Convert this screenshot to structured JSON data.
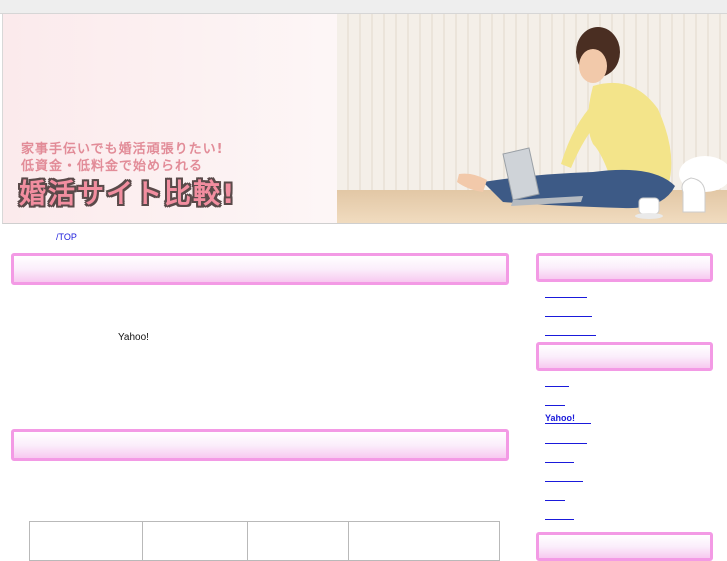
{
  "header": {
    "tagline_line1": "家事手伝いでも婚活頑張りたい!",
    "tagline_line2": "低資金・低料金で始められる",
    "title": "婚活サイト比較!"
  },
  "breadcrumb": {
    "label": "/TOP"
  },
  "main": {
    "body_text": "Yahoo!"
  },
  "sidebar": {
    "links_group1": [
      "",
      "",
      ""
    ],
    "links_group2": [
      "",
      "",
      "Yahoo!",
      "",
      "",
      "",
      "",
      ""
    ]
  },
  "colors": {
    "accent_pink": "#f39ae5",
    "link_blue": "#1a1adb",
    "title_pink": "#f28ea0"
  }
}
